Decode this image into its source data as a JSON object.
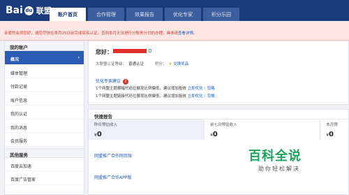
{
  "header": {
    "logo_text_bai": "Bai",
    "logo_paw": "du",
    "logo_text_lianmeng": "联盟",
    "tabs": [
      "账户首页",
      "合作管理",
      "效果报告",
      "优化专家",
      "积分乐园"
    ]
  },
  "notice": {
    "text": "亲爱的会员您好，请您尽快在本月25日前完成实名认证，否则本月无法进行分账务分付的办理。具体请",
    "link": "查看详情",
    "end": "。"
  },
  "sidebar": {
    "section1_title": "我的账户",
    "items": [
      "概况",
      "媒体管理",
      "付款记录",
      "账户信息",
      "我的认证",
      "我的消息",
      "会员服务"
    ],
    "section2_title": "其他服务",
    "items2": [
      "百度云加速",
      "百度广告管家"
    ]
  },
  "overview": {
    "greeting": "您好：",
    "member_label": "太联盟认证等级：",
    "member_value": "普通认证",
    "points_label": "积分：",
    "exchange": "兑换奖品",
    "optimize_label": "优化专家建议",
    "optimize_count": "2",
    "advices": [
      {
        "text": "1个网盟主题横幅代码位展现比例偏低，建议增加投放",
        "link1": "立即优化",
        "link2": "忽略"
      },
      {
        "text": "1个网盟主题链接代码位展现比例偏低，建议增加投放",
        "link1": "立即优化",
        "link2": "忽略"
      }
    ]
  },
  "quick_report": {
    "title": "快捷报告",
    "stats": [
      {
        "label": "昨日预估收入",
        "currency": "¥",
        "value": "0"
      },
      {
        "label": "前七日预估收入",
        "currency": "¥",
        "value": "0"
      },
      {
        "label": "本月预",
        "currency": "¥",
        "value": "0"
      }
    ],
    "links": [
      "网盟推广合作网页版",
      "网盟推广合作APP版"
    ]
  },
  "watermark": {
    "big": "百科全说",
    "small": "助你轻松解决"
  }
}
